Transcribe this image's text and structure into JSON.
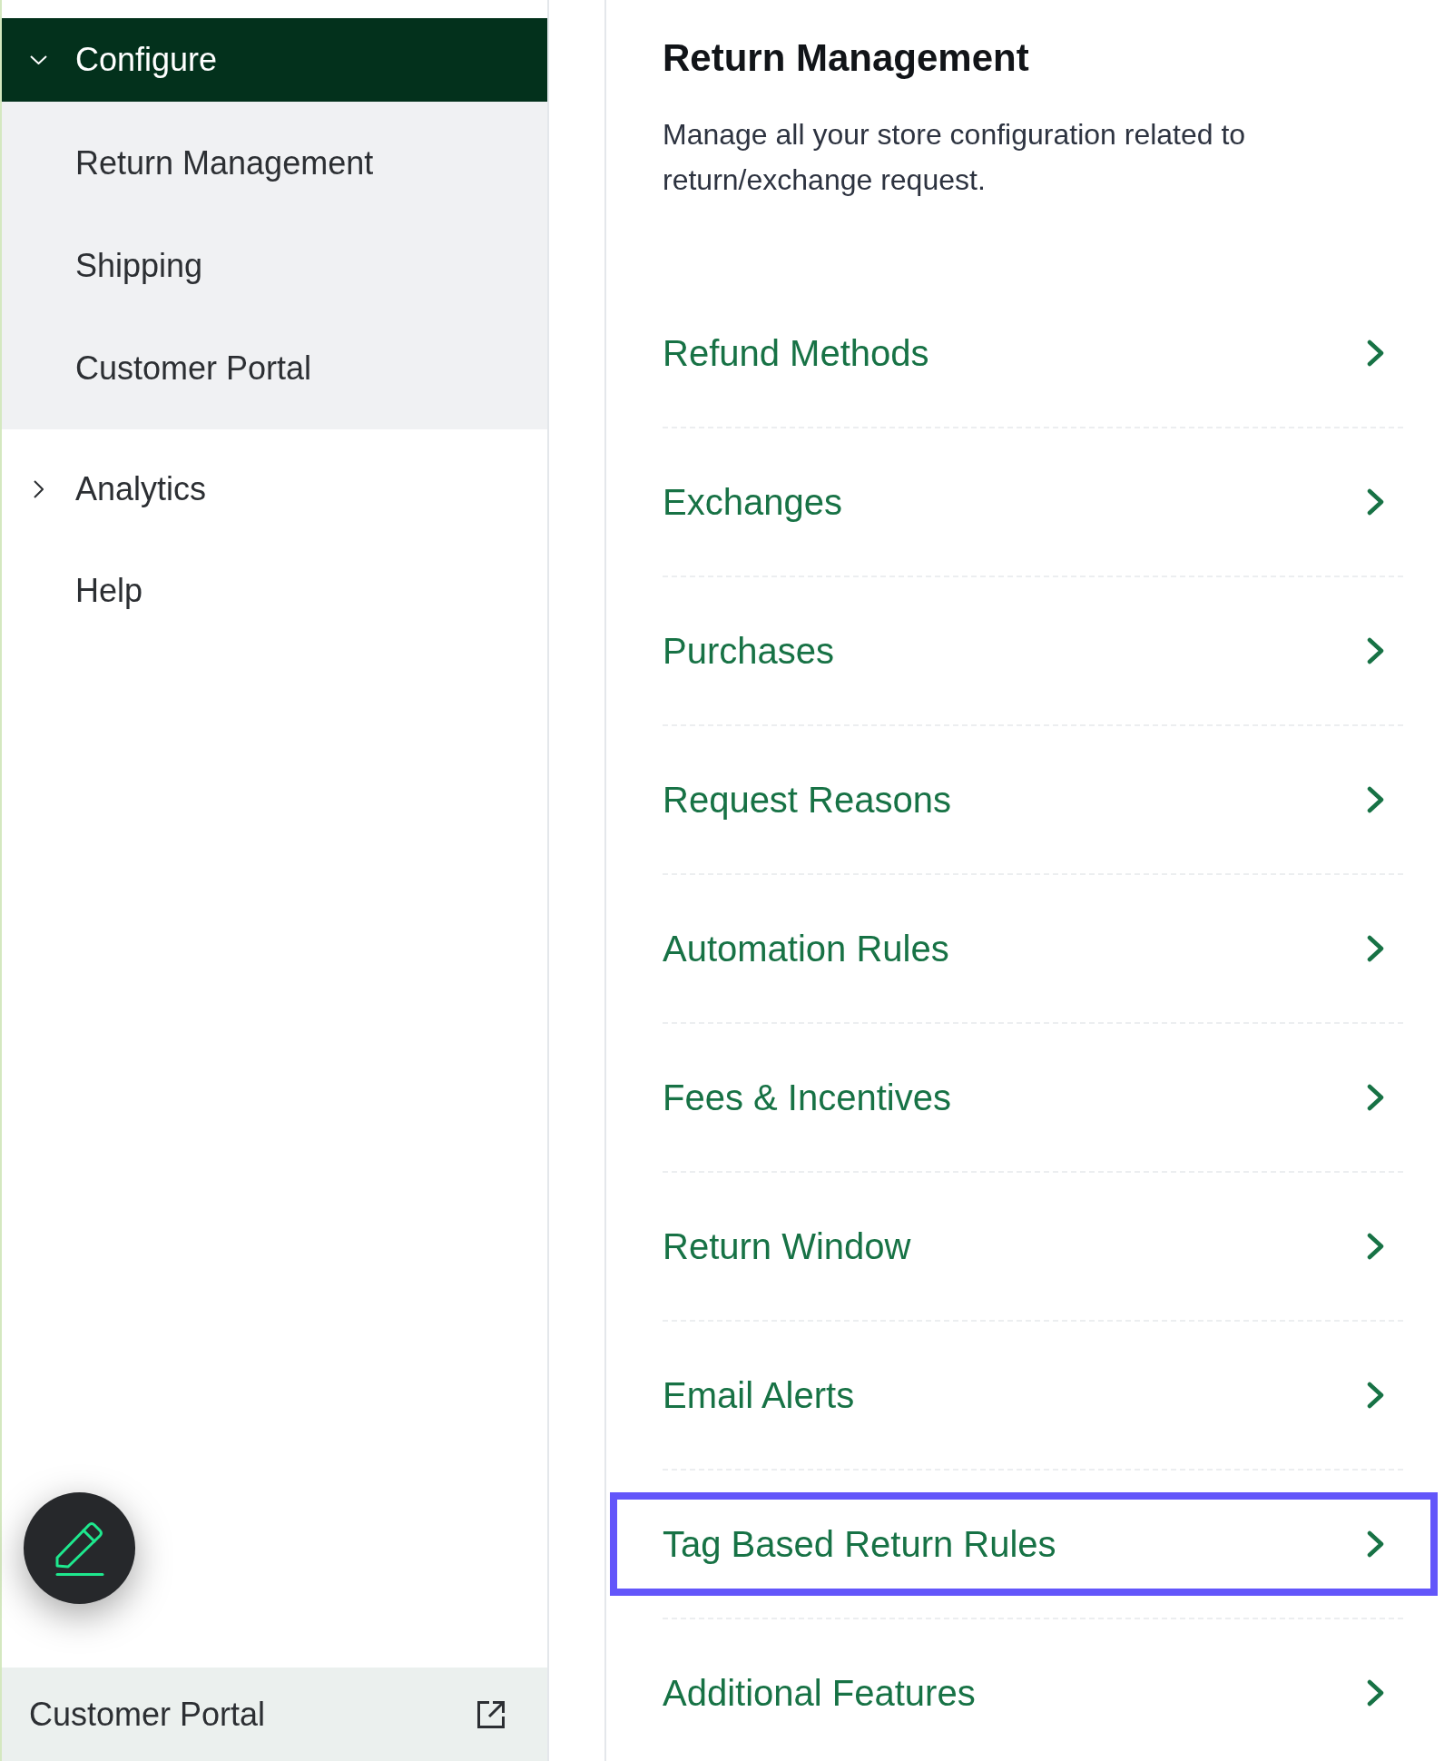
{
  "sidebar": {
    "sections": [
      {
        "kind": "group",
        "label": "Configure",
        "selected": true,
        "expanded": true,
        "children": [
          {
            "label": "Return Management",
            "selected": false
          },
          {
            "label": "Shipping",
            "selected": false
          },
          {
            "label": "Customer Portal",
            "selected": false
          }
        ]
      },
      {
        "kind": "group",
        "label": "Analytics",
        "selected": false,
        "expanded": false
      },
      {
        "kind": "link",
        "label": "Help",
        "selected": false
      }
    ],
    "footer_link": {
      "label": "Customer Portal"
    }
  },
  "page": {
    "title": "Return Management",
    "description": "Manage all your store configuration related to return/exchange request.",
    "items": [
      {
        "label": "Refund Methods",
        "highlighted": false
      },
      {
        "label": "Exchanges",
        "highlighted": false
      },
      {
        "label": "Purchases",
        "highlighted": false
      },
      {
        "label": "Request Reasons",
        "highlighted": false
      },
      {
        "label": "Automation Rules",
        "highlighted": false
      },
      {
        "label": "Fees & Incentives",
        "highlighted": false
      },
      {
        "label": "Return Window",
        "highlighted": false
      },
      {
        "label": "Email Alerts",
        "highlighted": false
      },
      {
        "label": "Tag Based Return Rules",
        "highlighted": true
      },
      {
        "label": "Additional Features",
        "highlighted": false
      }
    ]
  }
}
